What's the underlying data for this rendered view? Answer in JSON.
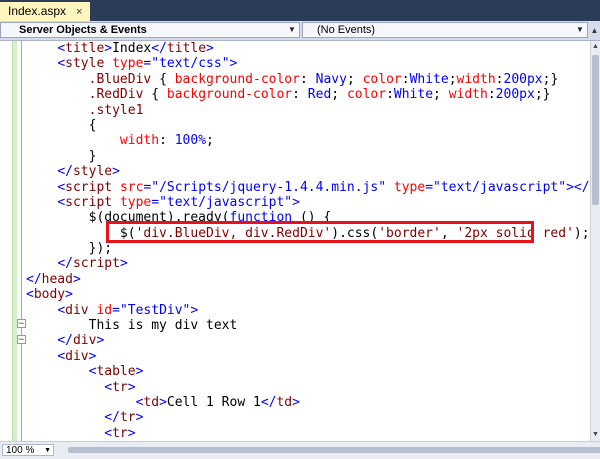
{
  "tab": {
    "label": "Index.aspx",
    "close": "×"
  },
  "nav": {
    "left": "Server Objects & Events",
    "right": "(No Events)"
  },
  "zoom": "100 %",
  "lines": [
    [
      [
        "    ",
        ""
      ],
      [
        "<",
        "b"
      ],
      [
        "title",
        "t"
      ],
      [
        ">",
        "b"
      ],
      [
        "Index",
        ""
      ],
      [
        "</",
        "b"
      ],
      [
        "title",
        "t"
      ],
      [
        ">",
        "b"
      ]
    ],
    [
      [
        "    ",
        ""
      ],
      [
        "<",
        "b"
      ],
      [
        "style",
        "t"
      ],
      [
        " ",
        ""
      ],
      [
        "type",
        "a"
      ],
      [
        "=",
        "b"
      ],
      [
        "\"text/css\"",
        "s"
      ],
      [
        ">",
        "b"
      ]
    ],
    [
      [
        "        ",
        ""
      ],
      [
        ".BlueDiv",
        "t"
      ],
      [
        " { ",
        ""
      ],
      [
        "background-color",
        "a"
      ],
      [
        ": ",
        ""
      ],
      [
        "Navy",
        "p"
      ],
      [
        "; ",
        ""
      ],
      [
        "color",
        "a"
      ],
      [
        ":",
        ""
      ],
      [
        "White",
        "p"
      ],
      [
        ";",
        ""
      ],
      [
        "width",
        "a"
      ],
      [
        ":",
        ""
      ],
      [
        "200px",
        "p"
      ],
      [
        ";}",
        ""
      ]
    ],
    [
      [
        "        ",
        ""
      ],
      [
        ".RedDiv",
        "t"
      ],
      [
        " { ",
        ""
      ],
      [
        "background-color",
        "a"
      ],
      [
        ": ",
        ""
      ],
      [
        "Red",
        "p"
      ],
      [
        "; ",
        ""
      ],
      [
        "color",
        "a"
      ],
      [
        ":",
        ""
      ],
      [
        "White",
        "p"
      ],
      [
        "; ",
        ""
      ],
      [
        "width",
        "a"
      ],
      [
        ":",
        ""
      ],
      [
        "200px",
        "p"
      ],
      [
        ";}",
        ""
      ]
    ],
    [
      [
        "        ",
        ""
      ],
      [
        ".style1",
        "t"
      ]
    ],
    [
      [
        "        {",
        ""
      ]
    ],
    [
      [
        "            ",
        ""
      ],
      [
        "width",
        "a"
      ],
      [
        ": ",
        ""
      ],
      [
        "100%",
        "p"
      ],
      [
        ";",
        ""
      ]
    ],
    [
      [
        "        }",
        ""
      ]
    ],
    [
      [
        "    ",
        ""
      ],
      [
        "</",
        "b"
      ],
      [
        "style",
        "t"
      ],
      [
        ">",
        "b"
      ]
    ],
    [
      [
        "    ",
        ""
      ],
      [
        "<",
        "b"
      ],
      [
        "script",
        "t"
      ],
      [
        " ",
        ""
      ],
      [
        "src",
        "a"
      ],
      [
        "=",
        "b"
      ],
      [
        "\"/Scripts/jquery-1.4.4.min.js\"",
        "s"
      ],
      [
        " ",
        ""
      ],
      [
        "type",
        "a"
      ],
      [
        "=",
        "b"
      ],
      [
        "\"text/javascript\"",
        "s"
      ],
      [
        "></",
        "b"
      ],
      [
        "script",
        "t"
      ],
      [
        ">",
        "b"
      ]
    ],
    [
      [
        "    ",
        ""
      ],
      [
        "<",
        "b"
      ],
      [
        "script",
        "t"
      ],
      [
        " ",
        ""
      ],
      [
        "type",
        "a"
      ],
      [
        "=",
        "b"
      ],
      [
        "\"text/javascript\"",
        "s"
      ],
      [
        ">",
        "b"
      ]
    ],
    [
      [
        "        $(document).ready(",
        ""
      ],
      [
        "function",
        "b"
      ],
      [
        " () {",
        ""
      ]
    ],
    [
      [
        "            $(",
        ""
      ],
      [
        "'div.BlueDiv, div.RedDiv'",
        "t"
      ],
      [
        ").css(",
        ""
      ],
      [
        "'border'",
        "t"
      ],
      [
        ", ",
        ""
      ],
      [
        "'2px solid red'",
        "t"
      ],
      [
        ");",
        ""
      ]
    ],
    [
      [
        "        });",
        ""
      ]
    ],
    [
      [
        "    ",
        ""
      ],
      [
        "</",
        "b"
      ],
      [
        "script",
        "t"
      ],
      [
        ">",
        "b"
      ]
    ],
    [
      [
        "",
        ""
      ],
      [
        "</",
        "b"
      ],
      [
        "head",
        "t"
      ],
      [
        ">",
        "b"
      ]
    ],
    [
      [
        "",
        ""
      ],
      [
        "<",
        "b"
      ],
      [
        "body",
        "t"
      ],
      [
        ">",
        "b"
      ]
    ],
    [
      [
        "    ",
        ""
      ],
      [
        "<",
        "b"
      ],
      [
        "div",
        "t"
      ],
      [
        " ",
        ""
      ],
      [
        "id",
        "a"
      ],
      [
        "=",
        "b"
      ],
      [
        "\"TestDiv\"",
        "s"
      ],
      [
        ">",
        "b"
      ]
    ],
    [
      [
        "        This is my div text",
        ""
      ]
    ],
    [
      [
        "    ",
        ""
      ],
      [
        "</",
        "b"
      ],
      [
        "div",
        "t"
      ],
      [
        ">",
        "b"
      ]
    ],
    [
      [
        "    ",
        ""
      ],
      [
        "<",
        "b"
      ],
      [
        "div",
        "t"
      ],
      [
        ">",
        "b"
      ]
    ],
    [
      [
        "        ",
        ""
      ],
      [
        "<",
        "b"
      ],
      [
        "table",
        "t"
      ],
      [
        ">",
        "b"
      ]
    ],
    [
      [
        "          ",
        ""
      ],
      [
        "<",
        "b"
      ],
      [
        "tr",
        "t"
      ],
      [
        ">",
        "b"
      ]
    ],
    [
      [
        "              ",
        ""
      ],
      [
        "<",
        "b"
      ],
      [
        "td",
        "t"
      ],
      [
        ">",
        "b"
      ],
      [
        "Cell 1 Row 1",
        ""
      ],
      [
        "</",
        "b"
      ],
      [
        "td",
        "t"
      ],
      [
        ">",
        "b"
      ]
    ],
    [
      [
        "          ",
        ""
      ],
      [
        "</",
        "b"
      ],
      [
        "tr",
        "t"
      ],
      [
        ">",
        "b"
      ]
    ],
    [
      [
        "          ",
        ""
      ],
      [
        "<",
        "b"
      ],
      [
        "tr",
        "t"
      ],
      [
        ">",
        "b"
      ]
    ]
  ]
}
